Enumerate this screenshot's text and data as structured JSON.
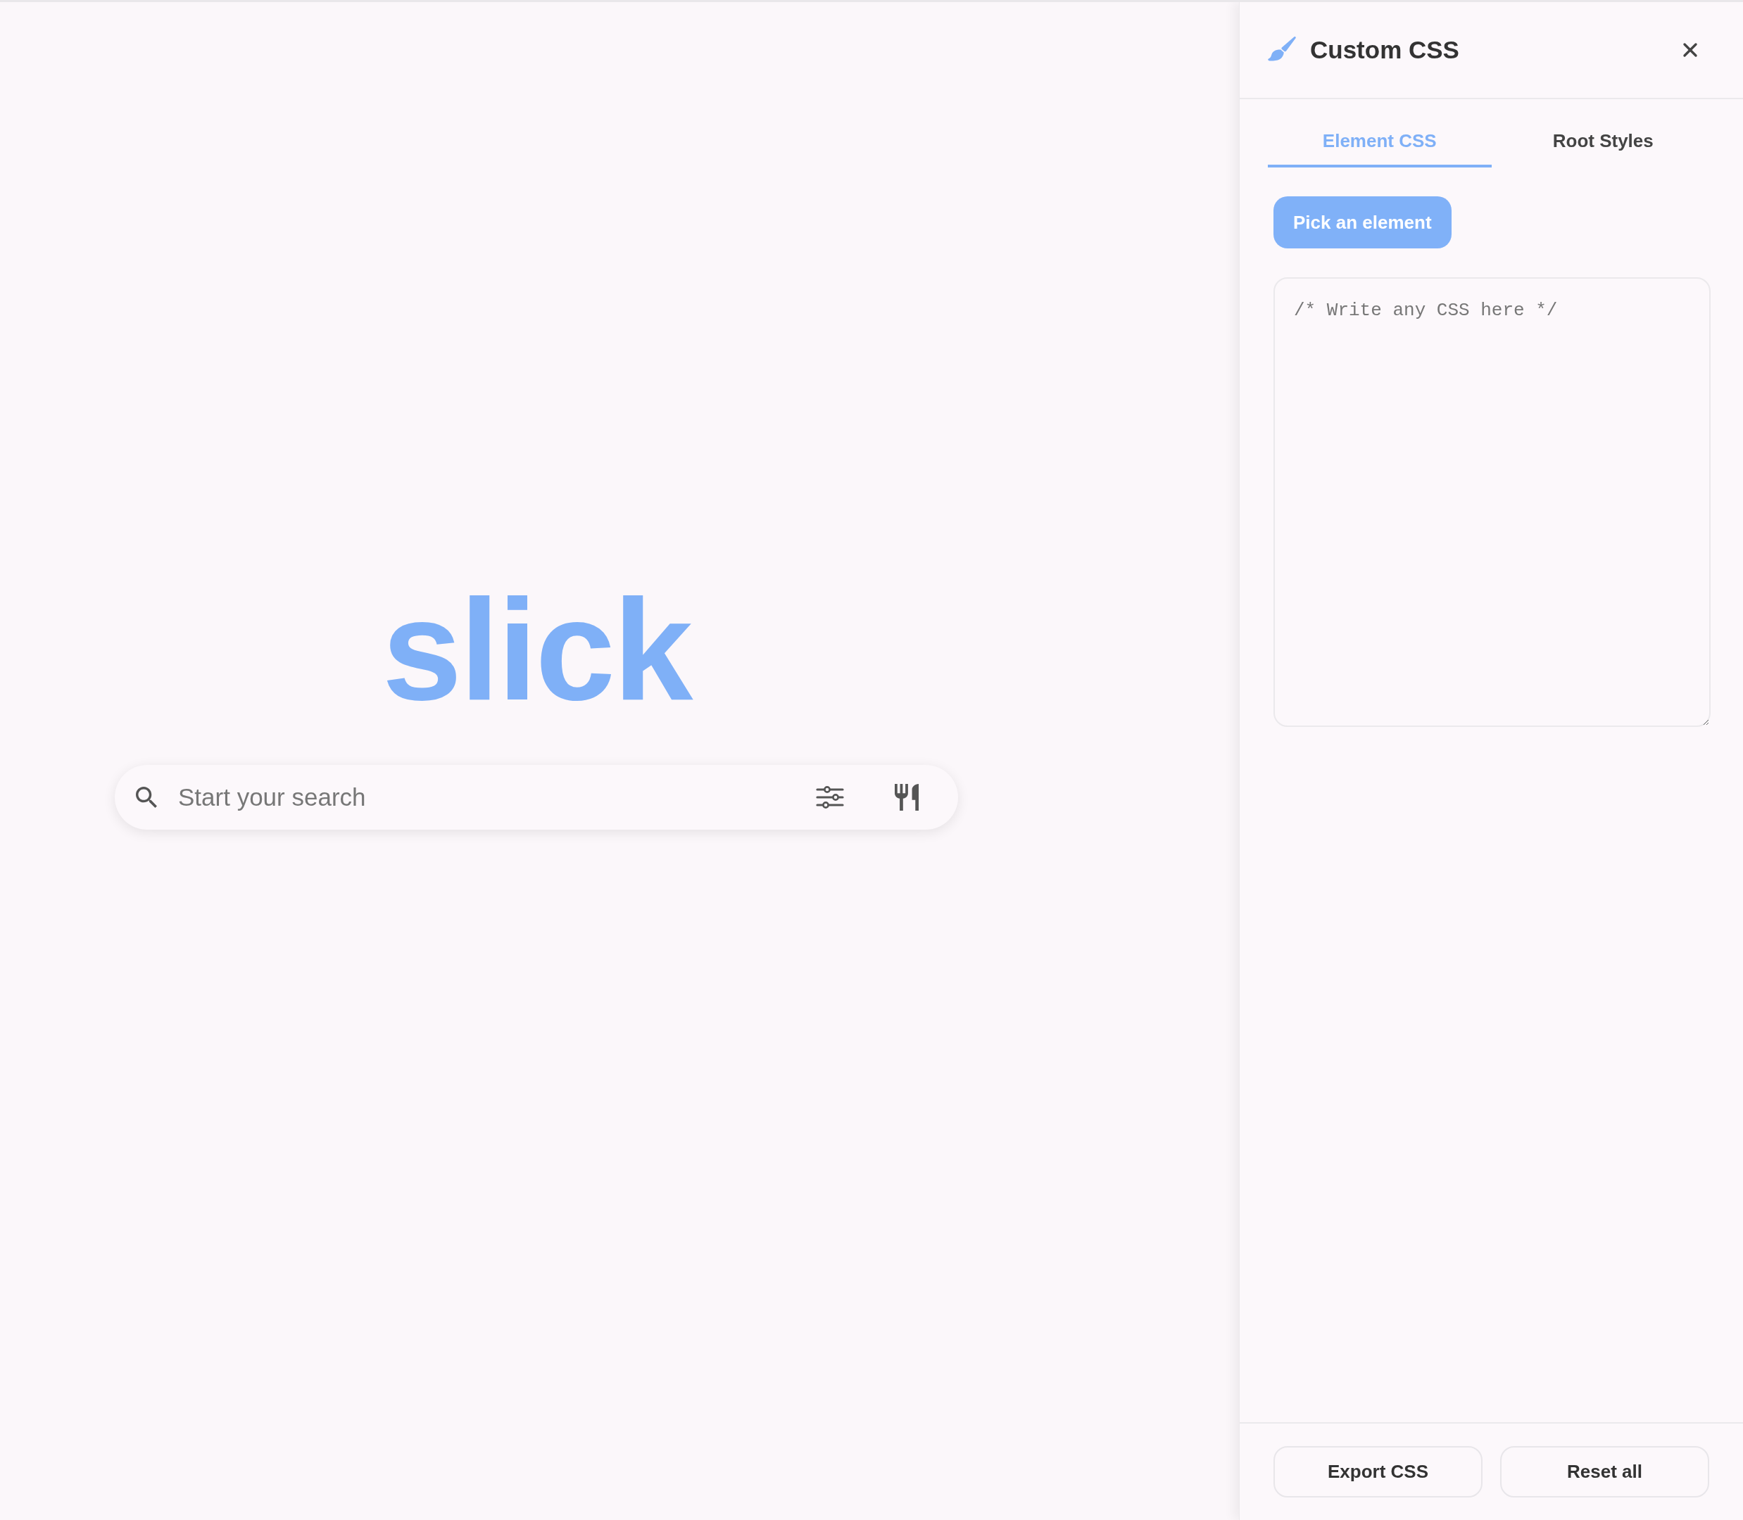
{
  "logo": {
    "text": "slick"
  },
  "search": {
    "placeholder": "Start your search"
  },
  "panel": {
    "title": "Custom CSS",
    "tabs": [
      {
        "label": "Element CSS",
        "selected": true
      },
      {
        "label": "Root Styles",
        "selected": false
      }
    ],
    "pick_button": "Pick an element",
    "editor": {
      "placeholder": "/* Write any CSS here */"
    },
    "footer_buttons": [
      "Export CSS",
      "Reset all"
    ]
  }
}
